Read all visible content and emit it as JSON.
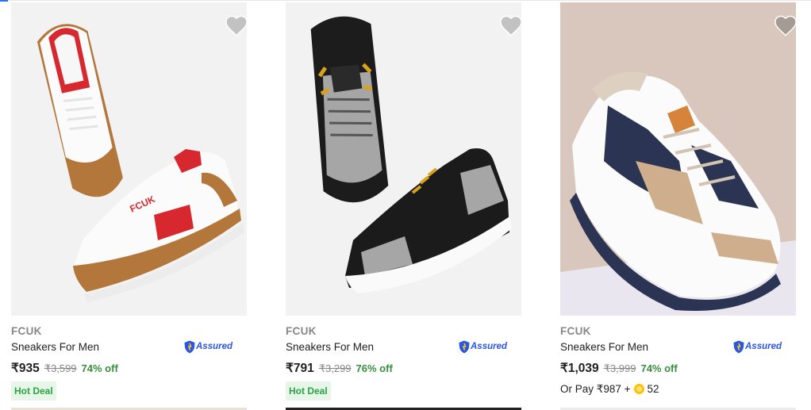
{
  "colors": {
    "accent": "#2874f0",
    "offer_green": "#388e3c",
    "deal_bg": "#e8f5e9",
    "assured_blue": "#2a55e5"
  },
  "products": [
    {
      "brand": "FCUK",
      "title": "Sneakers For Men",
      "assured_label": "Assured",
      "price": "₹935",
      "mrp": "₹3,599",
      "discount": "74% off",
      "badge": "Hot Deal",
      "wishlist_icon": "heart-icon"
    },
    {
      "brand": "FCUK",
      "title": "Sneakers For Men",
      "assured_label": "Assured",
      "price": "₹791",
      "mrp": "₹3,299",
      "discount": "76% off",
      "badge": "Hot Deal",
      "wishlist_icon": "heart-icon"
    },
    {
      "brand": "FCUK",
      "title": "Sneakers For Men",
      "assured_label": "Assured",
      "price": "₹1,039",
      "mrp": "₹3,999",
      "discount": "74% off",
      "or_pay_prefix": "Or Pay ₹987 +",
      "or_pay_coins": "52",
      "wishlist_icon": "heart-icon"
    }
  ]
}
